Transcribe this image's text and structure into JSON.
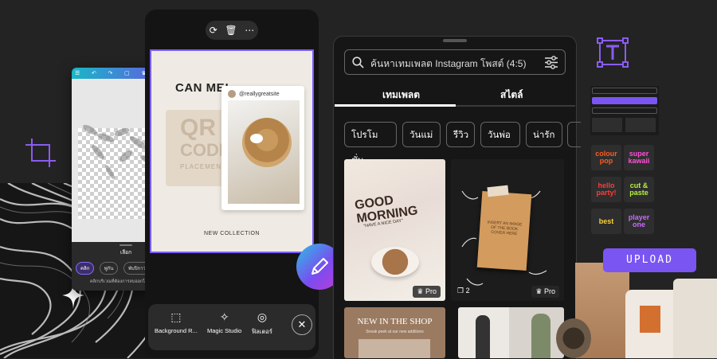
{
  "left_editor": {
    "sheet_title": "เลือก",
    "options": [
      "คลิก",
      "พู่กัน",
      "พับปิกาวร์"
    ],
    "hint": "คลิกบริเวณที่ต้องการลบออกไปทุกแบบ"
  },
  "design": {
    "scan_text": "CAN ME!",
    "handle": "@reallygreatsite",
    "qr_text": "QR",
    "code_text": "CODE",
    "placement_text": "PLACEMENT",
    "collection_text": "NEW COLLECTION"
  },
  "bottom_toolbar": {
    "items": [
      {
        "label": "Background R...",
        "icon": "background-remover-icon"
      },
      {
        "label": "Magic Studio",
        "icon": "magic-studio-icon"
      },
      {
        "label": "ฟิลเตอร์",
        "icon": "filter-icon"
      }
    ],
    "close": "✕"
  },
  "panel": {
    "search_placeholder": "ค้นหาเทมเพลต Instagram โพสต์ (4:5)",
    "tabs": [
      "เทมเพลต",
      "สไตล์"
    ],
    "chips": [
      "โปรโมชั่น",
      "วันแม่",
      "รีวิว",
      "วันพ่อ",
      "น่ารัก"
    ],
    "cards": [
      {
        "title": "GOOD MORNING",
        "subtitle": "\"HAVE A NICE DAY\"",
        "badge": "Pro"
      },
      {
        "title": "INSERT AN IMAGE OF THE BOOK COVER HERE",
        "badge": "Pro",
        "pages": "2"
      },
      {
        "title": "NEW IN THE SHOP",
        "subtitle": "Sneak peek at our new additions"
      }
    ]
  },
  "stickers": [
    "colour pop",
    "super kawaii",
    "hello party!",
    "cut & paste",
    "best",
    "player one"
  ],
  "upload_label": "UPLOAD",
  "colors": {
    "accent": "#7a55f2",
    "background": "#232323",
    "panel": "#161616"
  }
}
